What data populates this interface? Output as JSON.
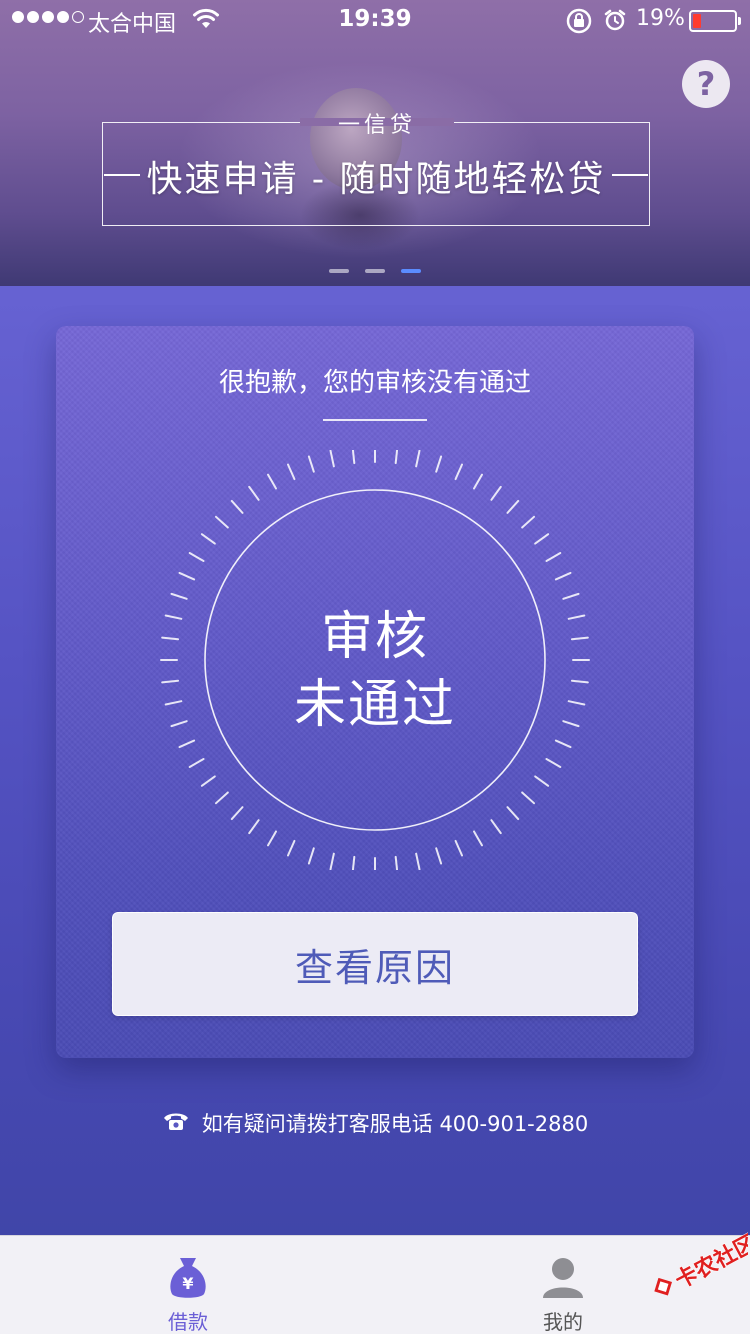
{
  "status_bar": {
    "carrier": "太合中国",
    "time": "19:39",
    "battery": "19%",
    "battery_level": 0.19,
    "signal_bars": 4,
    "signal_total": 5
  },
  "banner": {
    "label_top": "一信贷",
    "headline": "快速申请 - 随时随地轻松贷",
    "help": "?",
    "pages": 3,
    "active_page": 3
  },
  "result": {
    "message": "很抱歉，您的审核没有通过",
    "status_line1": "审核",
    "status_line2": "未通过",
    "reason_button": "查看原因"
  },
  "hotline": {
    "text": "如有疑问请拨打客服电话 400-901-2880"
  },
  "tabs": [
    {
      "label": "借款",
      "icon": "money-bag-icon",
      "active": true
    },
    {
      "label": "我的",
      "icon": "person-icon",
      "active": false
    }
  ],
  "watermark": {
    "text": "卡农社区"
  },
  "colors": {
    "accent": "#6b5fd6",
    "button_text": "#4f5bb8",
    "battery_low": "#ff3b30",
    "page_active": "#5b8cff"
  }
}
